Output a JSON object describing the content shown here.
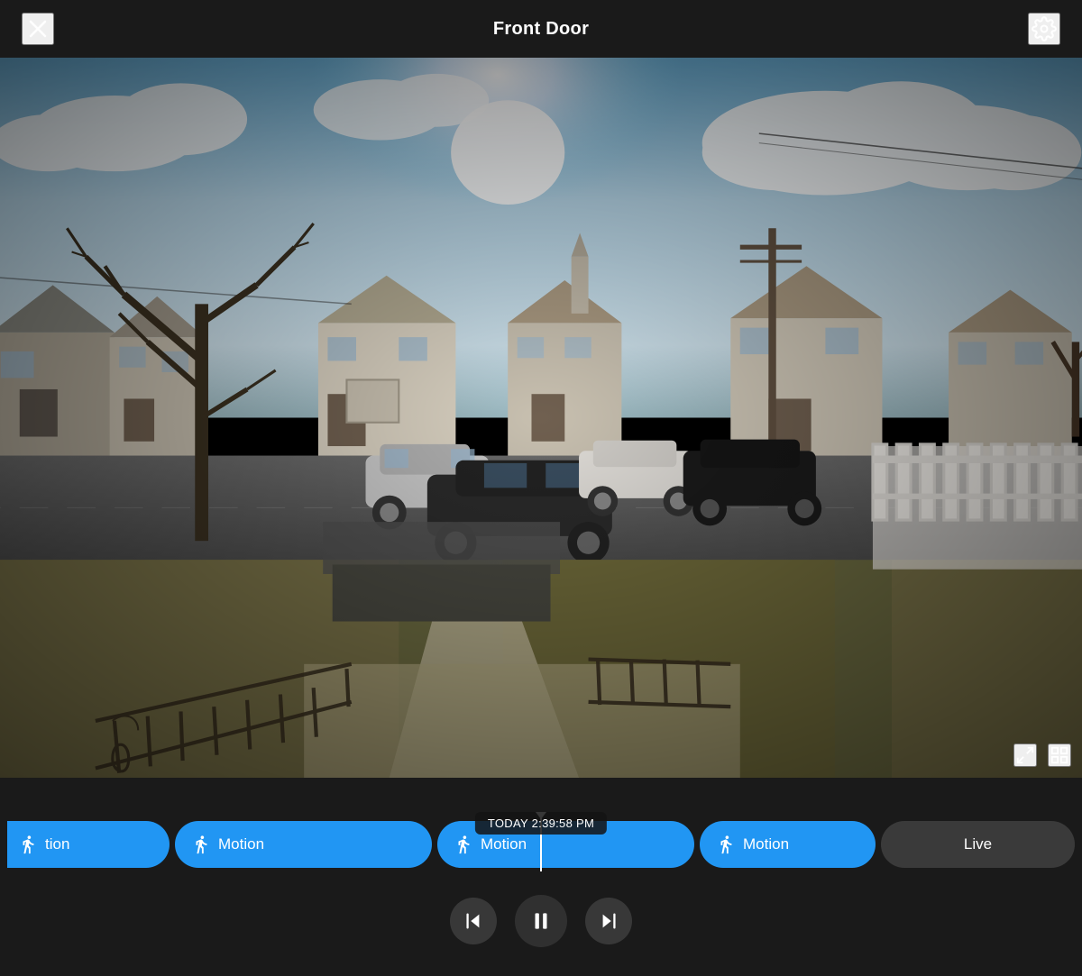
{
  "header": {
    "title": "Front Door",
    "close_label": "Close",
    "settings_label": "Settings"
  },
  "timestamp": {
    "label": "TODAY 2:39:58 PM"
  },
  "timeline": {
    "pills": [
      {
        "type": "partial",
        "label": "tion"
      },
      {
        "type": "full",
        "label": "Motion"
      },
      {
        "type": "full",
        "label": "Motion"
      },
      {
        "type": "full",
        "label": "Motion"
      },
      {
        "type": "live",
        "label": "Live"
      }
    ]
  },
  "controls": {
    "prev_label": "Previous",
    "pause_label": "Pause",
    "next_label": "Next"
  },
  "video": {
    "expand_label": "Expand",
    "fullscreen_label": "Fullscreen"
  }
}
